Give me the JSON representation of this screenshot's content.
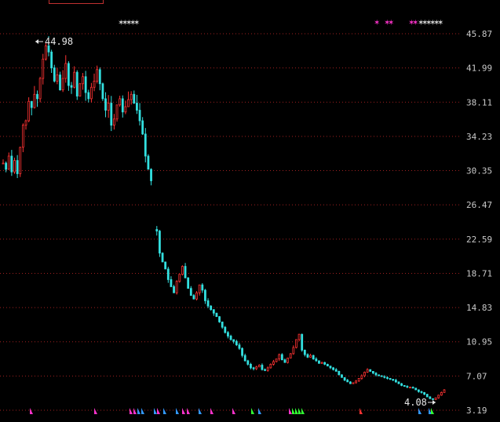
{
  "chart_data": {
    "type": "candlestick",
    "y_ticks": [
      45.87,
      41.99,
      38.11,
      34.23,
      30.35,
      26.47,
      22.59,
      18.71,
      14.83,
      10.95,
      7.07,
      3.19
    ],
    "ylim": [
      3.19,
      45.87
    ],
    "grid": true,
    "annotations": [
      {
        "label": "44.98",
        "value": 44.98,
        "kind": "high"
      },
      {
        "label": "4.08",
        "value": 4.08,
        "kind": "low"
      }
    ],
    "colors": {
      "up": "#ff3333",
      "down": "#33e0e0",
      "grid": "#a02020",
      "marker_pink": "#ff33cc",
      "marker_blue": "#3399ff",
      "marker_green": "#33ff33",
      "marker_red": "#ff3333",
      "star": "#d8d8d8"
    },
    "price_path": [
      31.2,
      30.5,
      32.0,
      30.2,
      31.5,
      30.0,
      33.0,
      35.5,
      36.0,
      38.2,
      37.5,
      39.0,
      38.5,
      40.8,
      43.0,
      44.5,
      43.8,
      42.0,
      40.5,
      41.2,
      39.5,
      40.8,
      42.5,
      40.0,
      39.8,
      41.5,
      38.8,
      40.2,
      41.0,
      39.2,
      38.5,
      39.8,
      40.5,
      41.8,
      40.2,
      38.5,
      37.2,
      38.0,
      35.5,
      36.2,
      37.8,
      38.5,
      37.0,
      37.6,
      38.4,
      39.0,
      38.0,
      37.2,
      36.0,
      34.5,
      32.0,
      30.5,
      29.2,
      0,
      23.5,
      21.0,
      20.0,
      19.2,
      18.0,
      17.2,
      16.5,
      17.8,
      18.6,
      19.5,
      18.2,
      17.0,
      16.2,
      15.8,
      16.5,
      17.4,
      16.8,
      15.6,
      15.0,
      14.6,
      14.2,
      13.8,
      13.2,
      12.6,
      12.0,
      11.6,
      11.2,
      11.0,
      10.6,
      10.2,
      9.4,
      8.8,
      8.4,
      8.0,
      7.9,
      8.1,
      8.3,
      7.8,
      7.7,
      8.0,
      8.4,
      8.7,
      9.0,
      9.5,
      8.9,
      8.6,
      9.1,
      9.6,
      10.3,
      11.2,
      11.8,
      10.0,
      9.5,
      9.2,
      9.4,
      9.0,
      8.8,
      8.5,
      8.6,
      8.4,
      8.2,
      8.0,
      7.8,
      7.6,
      7.2,
      6.9,
      6.6,
      6.4,
      6.2,
      6.3,
      6.5,
      6.8,
      7.1,
      7.5,
      7.8,
      7.6,
      7.4,
      7.2,
      7.1,
      7.0,
      6.9,
      6.8,
      6.7,
      6.6,
      6.4,
      6.2,
      6.0,
      5.9,
      5.8,
      5.8,
      5.7,
      5.5,
      5.3,
      5.2,
      5.0,
      4.7,
      4.5,
      4.4,
      4.6,
      4.9,
      5.2,
      5.5
    ],
    "bottom_markers": [
      {
        "color": "pink"
      },
      {
        "color": "pink"
      },
      {
        "color": "pink"
      },
      {
        "color": "pink"
      },
      {
        "color": "blue"
      },
      {
        "color": "blue"
      },
      {
        "color": "blue"
      },
      {
        "color": "pink"
      },
      {
        "color": "blue"
      },
      {
        "color": "blue"
      },
      {
        "color": "pink"
      },
      {
        "color": "pink"
      },
      {
        "color": "blue"
      },
      {
        "color": "pink"
      },
      {
        "color": "pink"
      },
      {
        "color": "green"
      },
      {
        "color": "blue"
      },
      {
        "color": "pink"
      },
      {
        "color": "green"
      },
      {
        "color": "green"
      },
      {
        "color": "green"
      },
      {
        "color": "green"
      },
      {
        "color": "red"
      },
      {
        "color": "blue"
      },
      {
        "color": "blue"
      },
      {
        "color": "green"
      }
    ],
    "top_markers": [
      {
        "color": "star",
        "count": 5
      },
      {
        "color": "pink",
        "count": 1
      },
      {
        "color": "pink",
        "count": 2
      },
      {
        "color": "pink",
        "count": 2
      },
      {
        "color": "star",
        "count": 6
      }
    ]
  }
}
